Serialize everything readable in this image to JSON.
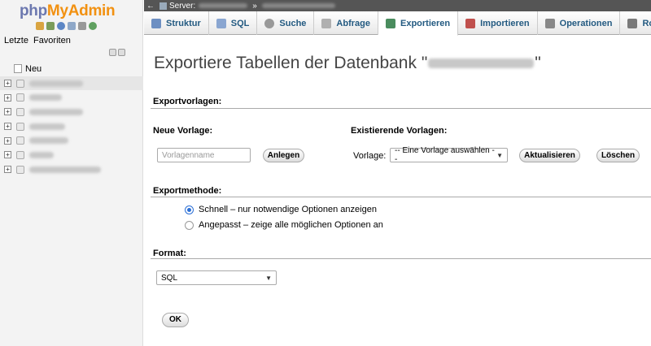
{
  "sidebar": {
    "logo": {
      "php": "php",
      "my": "My",
      "admin": "Admin"
    },
    "tabs": [
      "Letzte",
      "Favoriten"
    ],
    "new_label": "Neu",
    "databases": [
      {
        "name": "",
        "blur_width": 66,
        "highlighted": true
      },
      {
        "name": "",
        "blur_width": 40,
        "highlighted": false
      },
      {
        "name": "",
        "blur_width": 66,
        "highlighted": false
      },
      {
        "name": "",
        "blur_width": 44,
        "highlighted": false
      },
      {
        "name": "",
        "blur_width": 48,
        "highlighted": false
      },
      {
        "name": "",
        "blur_width": 30,
        "highlighted": false
      },
      {
        "name": "",
        "blur_width": 88,
        "highlighted": false
      }
    ]
  },
  "topbar": {
    "server_label": "Server: "
  },
  "tabs": [
    {
      "label": "Struktur",
      "icon": "structure-icon",
      "color": "#6d8fc2"
    },
    {
      "label": "SQL",
      "icon": "sql-icon",
      "color": "#8aa6d1"
    },
    {
      "label": "Suche",
      "icon": "search-icon",
      "color": "#999999"
    },
    {
      "label": "Abfrage",
      "icon": "query-icon",
      "color": "#b0b0b0"
    },
    {
      "label": "Exportieren",
      "icon": "export-icon",
      "color": "#4a8c5e",
      "active": true
    },
    {
      "label": "Importieren",
      "icon": "import-icon",
      "color": "#c0504d"
    },
    {
      "label": "Operationen",
      "icon": "wrench-icon",
      "color": "#888888"
    },
    {
      "label": "Routinen",
      "icon": "routines-icon",
      "color": "#7a7a7a"
    }
  ],
  "main": {
    "title_prefix": "Exportiere Tabellen der Datenbank \"",
    "title_suffix": "\"",
    "export_templates": {
      "heading": "Exportvorlagen:",
      "new_label": "Neue Vorlage:",
      "new_placeholder": "Vorlagenname",
      "create_button": "Anlegen",
      "existing_label": "Existierende Vorlagen:",
      "template_label": "Vorlage:",
      "template_selected": "-- Eine Vorlage auswählen --",
      "update_button": "Aktualisieren",
      "delete_button": "Löschen"
    },
    "export_method": {
      "heading": "Exportmethode:",
      "options": [
        {
          "label": "Schnell – nur notwendige Optionen anzeigen",
          "selected": true
        },
        {
          "label": "Angepasst – zeige alle möglichen Optionen an",
          "selected": false
        }
      ]
    },
    "format": {
      "heading": "Format:",
      "selected": "SQL"
    },
    "ok_button": "OK"
  },
  "colors": {
    "accent_link": "#235a81",
    "logo_php": "#6c78af",
    "logo_myadmin": "#f29111",
    "radio_selected": "#2b6fd6"
  }
}
